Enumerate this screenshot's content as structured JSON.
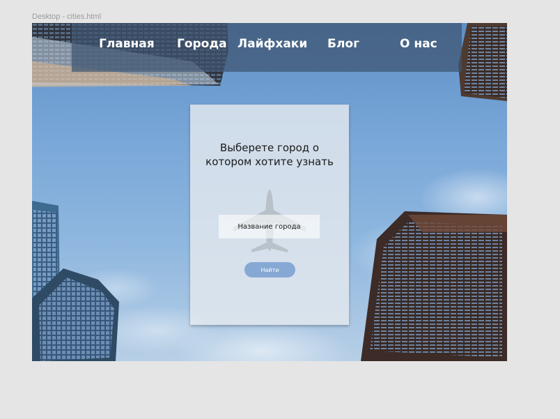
{
  "frame": {
    "label": "Desktop - cities.html"
  },
  "nav": {
    "items": [
      {
        "label": "Главная"
      },
      {
        "label": "Города"
      },
      {
        "label": "Лайфхаки"
      },
      {
        "label": "Блог"
      },
      {
        "label": "О нас"
      }
    ]
  },
  "search_card": {
    "title": "Выберете город о котором хотите узнать",
    "input": {
      "value": "",
      "placeholder": "Название города"
    },
    "button_label": "Найти",
    "icon": "airplane-icon"
  },
  "colors": {
    "nav_background": "#3e5470",
    "button": "#86a8d5",
    "page_background": "#e5e5e5"
  }
}
